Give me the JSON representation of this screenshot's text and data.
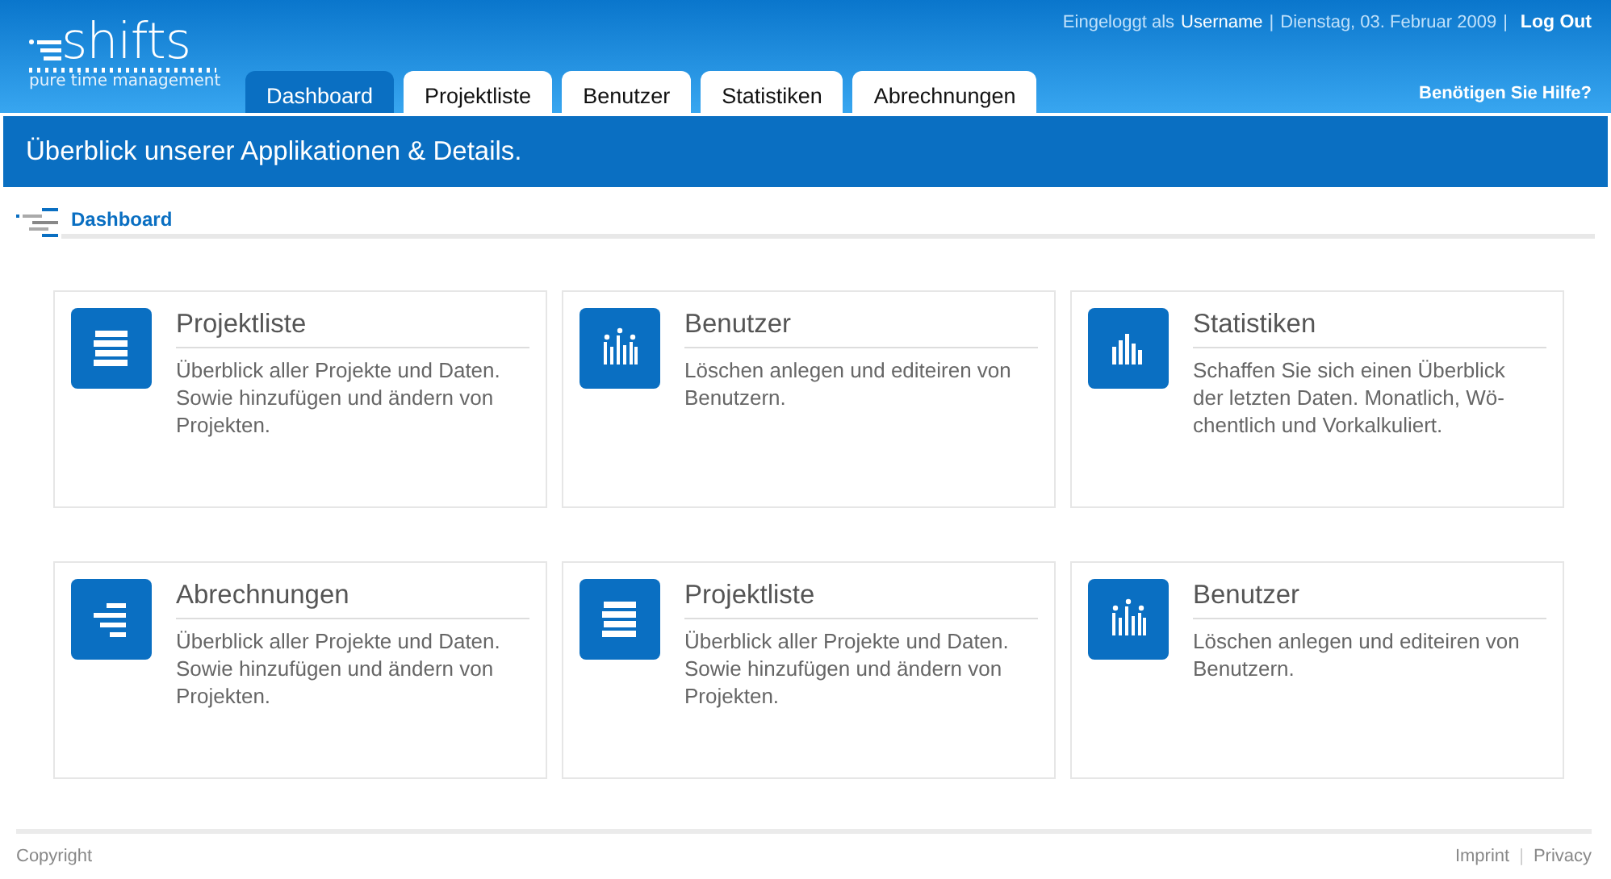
{
  "logo": {
    "name": "shifts",
    "tagline": "pure time management"
  },
  "user_bar": {
    "login_label": "Eingeloggt als",
    "username": "Username",
    "separator": "|",
    "date": "Dienstag, 03. Februar 2009",
    "logout": "Log Out"
  },
  "tabs": [
    {
      "label": "Dashboard",
      "selected": true
    },
    {
      "label": "Projektliste",
      "selected": false
    },
    {
      "label": "Benutzer",
      "selected": false
    },
    {
      "label": "Statistiken",
      "selected": false
    },
    {
      "label": "Abrechnungen",
      "selected": false
    }
  ],
  "help_link": "Benötigen Sie Hilfe?",
  "banner": "Überblick unserer Applikationen & Details.",
  "breadcrumb": "Dashboard",
  "cards": [
    {
      "kind": "list",
      "title": "Projektliste",
      "text": "Überblick aller Projekte und Daten. Sowie hinzufügen und ändern von Projekten."
    },
    {
      "kind": "people",
      "title": "Benutzer",
      "text": "Löschen anlegen und editeiren von Benutzern."
    },
    {
      "kind": "bars",
      "title": "Statistiken",
      "text": "Schaffen Sie sich einen Überblick der letzten Daten. Monatlich, Wö-chentlich und Vorkalkuliert."
    },
    {
      "kind": "lines",
      "title": "Abrechnungen",
      "text": "Überblick aller Projekte und Daten. Sowie hinzufügen und ändern von Projekten."
    },
    {
      "kind": "list",
      "title": "Projektliste",
      "text": "Überblick aller Projekte und Daten. Sowie hinzufügen und ändern von Projekten."
    },
    {
      "kind": "people",
      "title": "Benutzer",
      "text": "Löschen anlegen und editeiren von Benutzern."
    }
  ],
  "footer": {
    "copyright": "Copyright",
    "links": [
      "Imprint",
      "Privacy"
    ],
    "separator": "|"
  }
}
